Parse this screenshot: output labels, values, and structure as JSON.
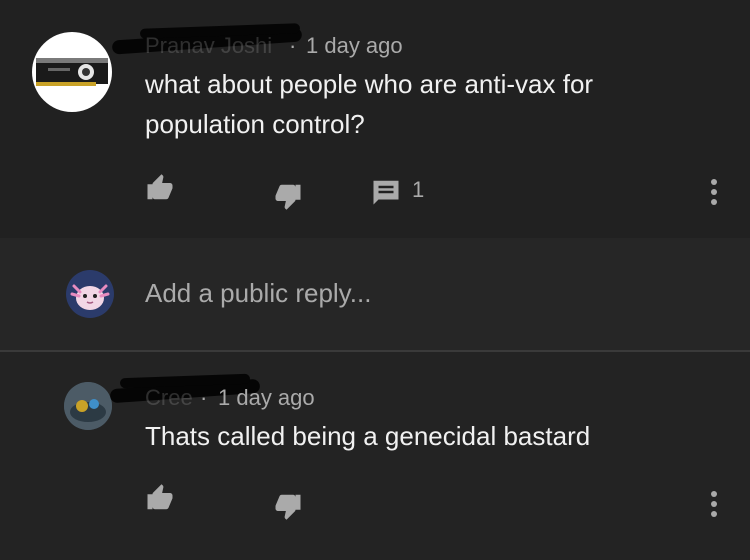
{
  "comments": [
    {
      "author": "Pranav Joshi",
      "time": "1 day ago",
      "text_line1": "what about people who are anti-vax for",
      "text_line2": "population control?",
      "reply_count": "1"
    },
    {
      "author": "Cree",
      "time": "1 day ago",
      "text_line1": "Thats called being a genecidal bastard"
    }
  ],
  "reply": {
    "placeholder": "Add a public reply..."
  },
  "colors": {
    "background": "#212121",
    "text_primary": "#f1f1f1",
    "text_secondary": "#aaaaaa",
    "icon": "#aaaaaa"
  }
}
